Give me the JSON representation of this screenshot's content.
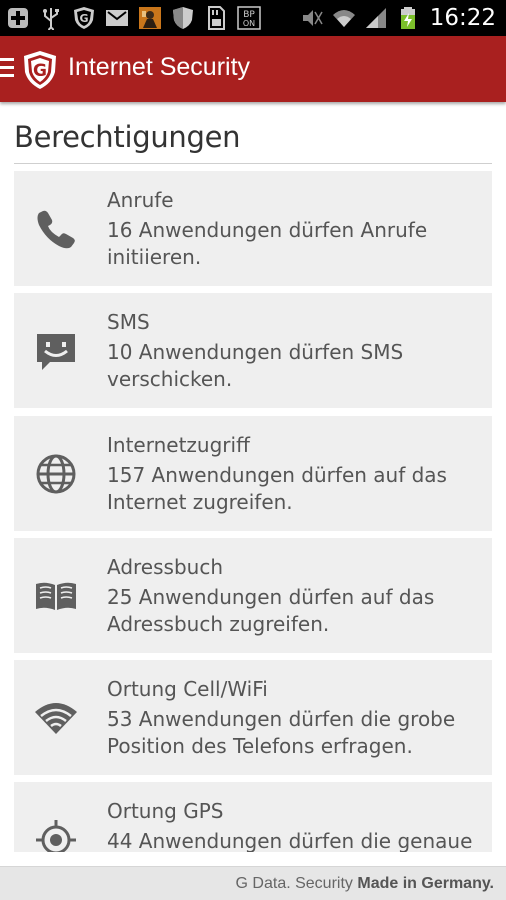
{
  "statusbar": {
    "time": "16:22",
    "icons": [
      "add-icon",
      "usb-icon",
      "gdata-shield-icon",
      "gmail-icon",
      "app-thumbnail-icon",
      "shield-icon",
      "sd-card-icon",
      "bp-on-icon",
      "mute-icon",
      "wifi-icon",
      "signal-icon",
      "battery-charging-icon"
    ]
  },
  "appbar": {
    "title": "Internet Security",
    "color": "#a9201f",
    "logo_letter": "G"
  },
  "page": {
    "title": "Berechtigungen"
  },
  "permissions": [
    {
      "title": "Anrufe",
      "description": "16 Anwendungen dürfen Anrufe initiieren.",
      "icon": "phone-icon"
    },
    {
      "title": "SMS",
      "description": "10 Anwendungen dürfen SMS verschicken.",
      "icon": "sms-icon"
    },
    {
      "title": "Internetzugriff",
      "description": "157 Anwendungen dürfen auf das Internet zugreifen.",
      "icon": "globe-icon"
    },
    {
      "title": "Adressbuch",
      "description": "25 Anwendungen dürfen auf das Adressbuch zugreifen.",
      "icon": "book-icon"
    },
    {
      "title": "Ortung Cell/WiFi",
      "description": "53 Anwendungen dürfen die grobe Position des Telefons erfragen.",
      "icon": "wifi-location-icon"
    },
    {
      "title": "Ortung GPS",
      "description": "44 Anwendungen dürfen die genaue",
      "icon": "gps-icon"
    }
  ],
  "footer": {
    "brand": "G Data. Security",
    "tagline": "Made in Germany."
  }
}
